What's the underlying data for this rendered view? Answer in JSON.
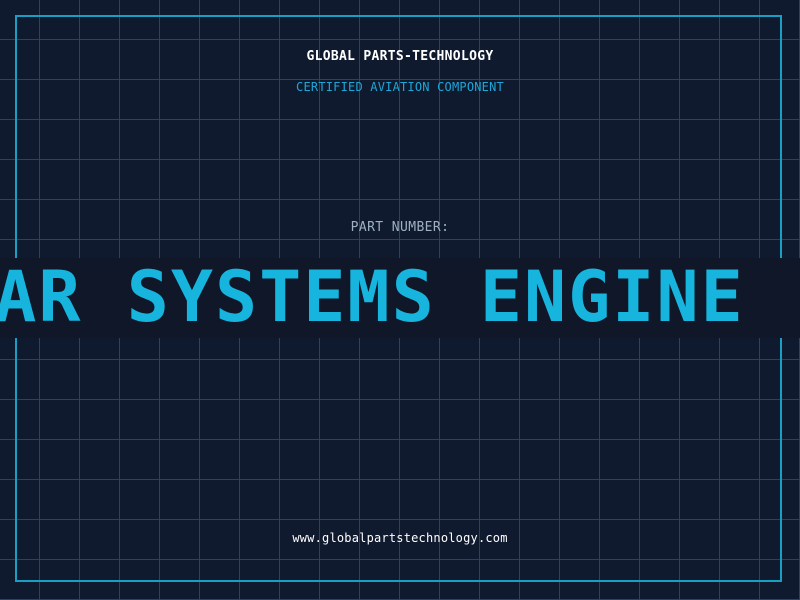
{
  "brand": {
    "title": "GLOBAL PARTS-TECHNOLOGY",
    "subtitle": "CERTIFIED AVIATION COMPONENT"
  },
  "part": {
    "label": "PART NUMBER:",
    "value": "ADAR SYSTEMS ENGINE"
  },
  "footer": {
    "website": "www.globalpartstechnology.com"
  },
  "colors": {
    "background": "#101a2e",
    "grid": "#1d4a63",
    "accent": "#17b4dd",
    "frame": "#1a9fc4",
    "label": "#9fb0c4",
    "text": "#ffffff"
  }
}
